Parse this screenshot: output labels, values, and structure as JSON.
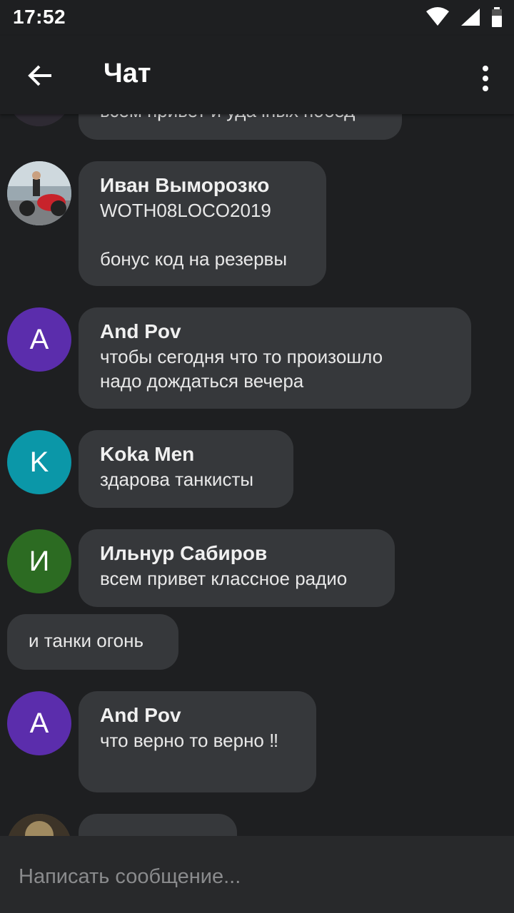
{
  "status": {
    "time": "17:52"
  },
  "header": {
    "title": "Чат"
  },
  "messages": [
    {
      "text": "всем привет и удачных побед"
    },
    {
      "name": "Иван Выморозко",
      "text": "WOTH08LOCO2019\n\nбонус код на резервы"
    },
    {
      "initial": "A",
      "avatar_color": "#5b2dac",
      "name": "And Pov",
      "text": "чтобы сегодня что то произошло\nнадо дождаться вечера"
    },
    {
      "initial": "K",
      "avatar_color": "#0b97a8",
      "name": "Koka Men",
      "text": "здарова танкисты"
    },
    {
      "initial": "И",
      "avatar_color": "#2c6b22",
      "name": "Ильнур Сабиров",
      "text": "всем привет классное радио"
    },
    {
      "text": "и танки огонь"
    },
    {
      "initial": "A",
      "avatar_color": "#5b2dac",
      "name": "And Pov",
      "text": "что верно то верно ‼"
    }
  ],
  "composer": {
    "placeholder": "Написать сообщение..."
  }
}
